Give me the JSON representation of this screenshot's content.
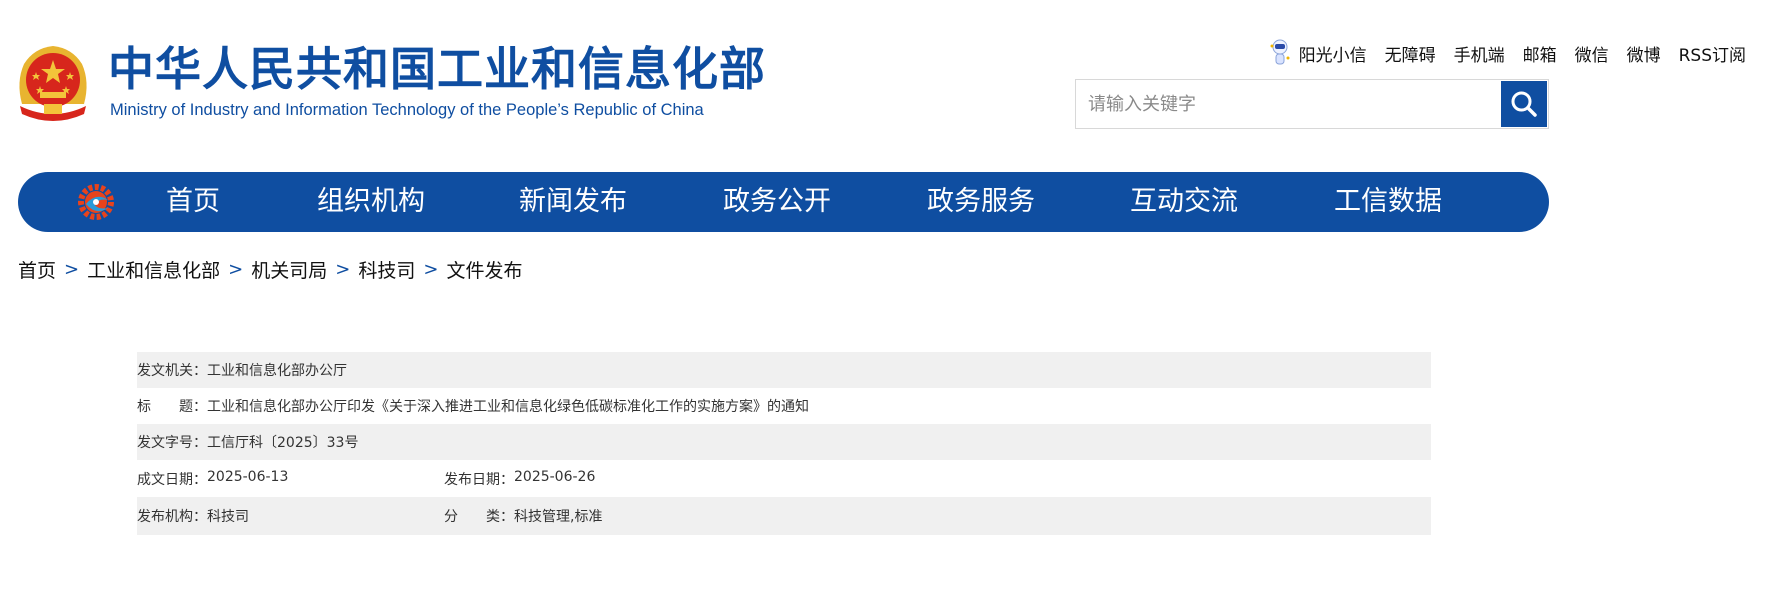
{
  "header": {
    "title_cn": "中华人民共和国工业和信息化部",
    "title_en": "Ministry of Industry and Information Technology of the People’s Republic of China",
    "top_links": [
      "阳光小信",
      "无障碍",
      "手机端",
      "邮箱",
      "微信",
      "微博",
      "RSS订阅"
    ],
    "search_placeholder": "请输入关键字",
    "icons": {
      "assistant": "robot-icon",
      "search": "search-icon",
      "emblem": "national-emblem"
    }
  },
  "nav": {
    "items": [
      "首页",
      "组织机构",
      "新闻发布",
      "政务公开",
      "政务服务",
      "互动交流",
      "工信数据"
    ],
    "colors": {
      "background": "#0f4ea1",
      "text": "#ffffff"
    }
  },
  "breadcrumb": [
    "首页",
    "工业和信息化部",
    "机关司局",
    "科技司",
    "文件发布"
  ],
  "meta": {
    "issuer_label": "发文机关：",
    "issuer": "工业和信息化部办公厅",
    "title_label": "标　　题：",
    "title": "工业和信息化部办公厅印发《关于深入推进工业和信息化绿色低碳标准化工作的实施方案》的通知",
    "doc_no_label": "发文字号：",
    "doc_no": "工信厅科〔2025〕33号",
    "written_date_label": "成文日期：",
    "written_date": "2025-06-13",
    "publish_date_label": "发布日期：",
    "publish_date": "2025-06-26",
    "publisher_label": "发布机构：",
    "publisher": "科技司",
    "category_label": "分　　类：",
    "category": "科技管理,标准"
  }
}
